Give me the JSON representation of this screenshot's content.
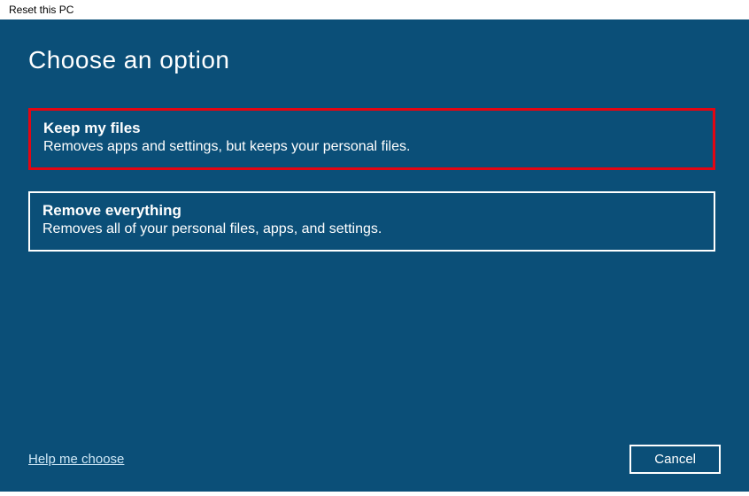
{
  "window": {
    "title": "Reset this PC"
  },
  "heading": "Choose an option",
  "options": [
    {
      "title": "Keep my files",
      "desc": "Removes apps and settings, but keeps your personal files."
    },
    {
      "title": "Remove everything",
      "desc": "Removes all of your personal files, apps, and settings."
    }
  ],
  "footer": {
    "help_link": "Help me choose",
    "cancel_label": "Cancel"
  }
}
